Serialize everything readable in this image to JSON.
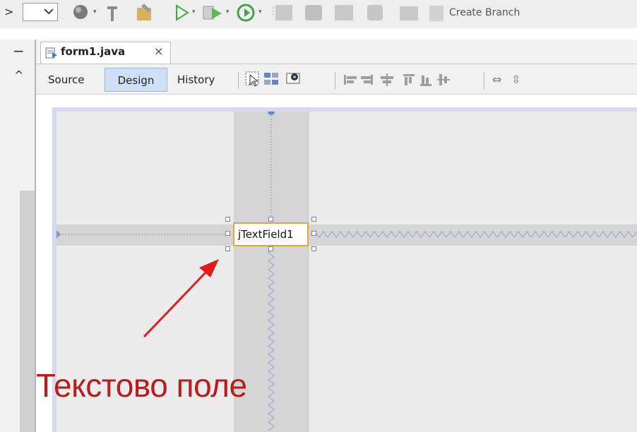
{
  "toolbar": {
    "left_glyph": ">",
    "create_branch_label": "Create Branch",
    "icons": [
      "dropdown-icon",
      "globe-icon",
      "build-icon",
      "clean-build-icon",
      "run-icon",
      "debug-icon",
      "profile-icon",
      "db-table-icon",
      "db-search-icon",
      "db-edit-icon",
      "database-icon",
      "db-connect-icon",
      "branch-icon"
    ]
  },
  "left_panel": {
    "collapse_glyph": "−",
    "scroll_up_glyph": "^"
  },
  "editor": {
    "tab": {
      "title": "form1.java",
      "close_glyph": "×"
    },
    "views": {
      "source": "Source",
      "design": "Design",
      "history": "History",
      "active": "Design"
    }
  },
  "design_canvas": {
    "component_label": "jTextField1"
  },
  "annotation": {
    "text": "Текстово поле",
    "color": "#b91c1c"
  },
  "colors": {
    "selection_border": "#e8a43a",
    "active_tab": "#cfe0f4",
    "form_frame": "#d8d8f2",
    "arrow": "#e31b1b"
  }
}
